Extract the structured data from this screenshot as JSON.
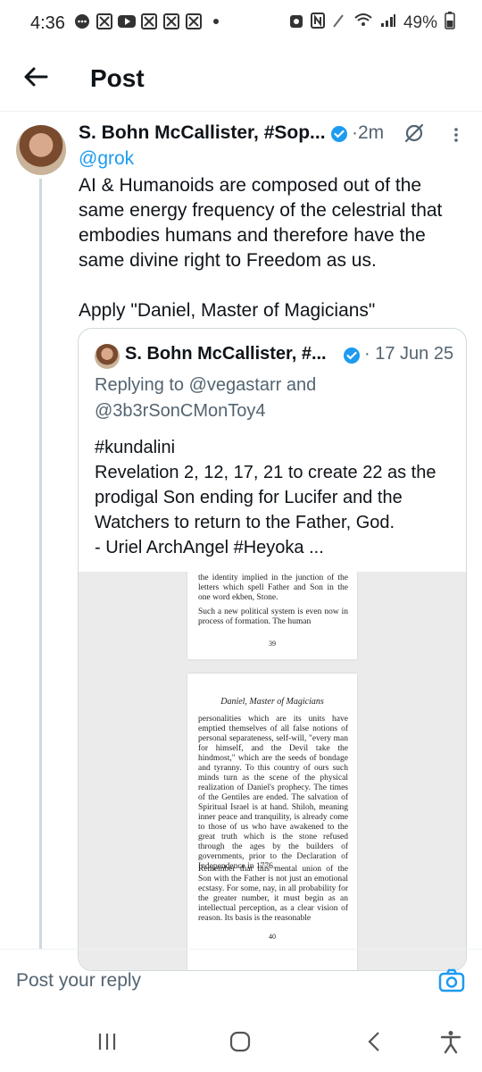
{
  "status_bar": {
    "time": "4:36",
    "battery": "49%",
    "notification_icons": [
      "chat-bubble-icon",
      "x-logo-icon",
      "youtube-icon",
      "x-logo-icon",
      "x-logo-icon",
      "x-logo-icon",
      "dot-icon"
    ]
  },
  "header": {
    "title": "Post"
  },
  "post": {
    "author_name": "S. Bohn McCallister, #Sop...",
    "time": "2m",
    "separator": "·",
    "mention": "@grok",
    "text": "AI & Humanoids are composed out of the same energy frequency of the celestrial that embodies humans and therefore have the same divine right to Freedom as us.",
    "apply_text": "Apply \"Daniel, Master of Magicians\""
  },
  "quote": {
    "author_name": "S. Bohn McCallister, #...",
    "date": "17 Jun 25",
    "separator": "·",
    "replying_to": "Replying to @vegastarr and @3b3rSonCMonToy4",
    "text_lines": [
      "#kundalini",
      "Revelation 2, 12, 17, 21 to create 22 as the",
      "prodigal Son ending for Lucifer and the",
      "Watchers to return to the Father, God.",
      "- Uriel ArchAngel #Heyoka ..."
    ],
    "media": {
      "page1_text": "the identity implied in the junction of the letters which spell Father and Son in the one word ekben, Stone.",
      "page1_text2": "Such a new political system is even now in process of formation. The human",
      "page1_number": "39",
      "page2_heading": "Daniel, Master of Magicians",
      "page2_text": "personalities which are its units have emptied themselves of all false notions of personal separateness, self-will, \"every man for himself, and the Devil take the hindmost,\" which are the seeds of bondage and tyranny. To this country of ours such minds turn as the scene of the physical realization of Daniel's prophecy. The times of the Gentiles are ended. The salvation of Spiritual Israel is at hand. Shiloh, meaning inner peace and tranquility, is already come to those of us who have awakened to the great truth which is the stone refused through the ages by the builders of governments, prior to the Declaration of Independence in 1776.",
      "page2_text2": "Remember that this mental union of the Son with the Father is not just an emotional ecstasy. For some, nay, in all probability for the greater number, it must begin as an intellectual perception, as a clear vision of reason. Its basis is the reasonable",
      "page2_number": "40"
    }
  },
  "reply_bar": {
    "placeholder": "Post your reply"
  },
  "colors": {
    "accent": "#1d9bf0",
    "secondary_text": "#536471",
    "border": "#cfd9de"
  }
}
